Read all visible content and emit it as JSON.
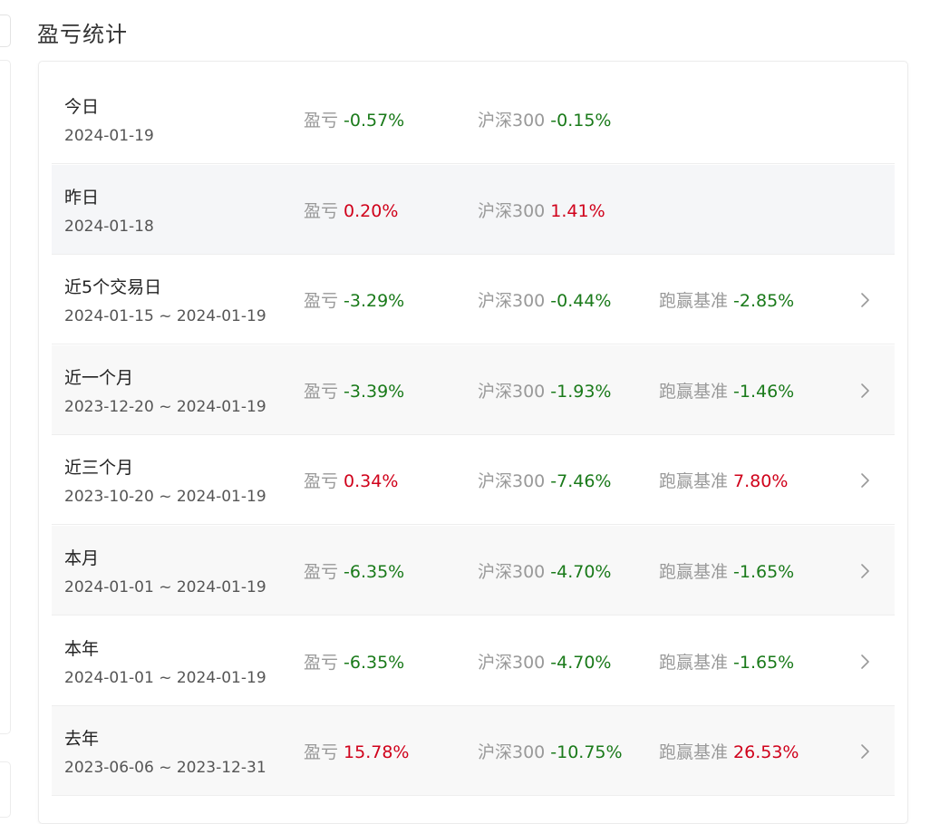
{
  "title": "盈亏统计",
  "labels": {
    "profit": "盈亏",
    "benchmark": "沪深300",
    "excess": "跑赢基准"
  },
  "colors": {
    "positive": "#d0021b",
    "negative": "#1a7a1a",
    "label": "#999999"
  },
  "rows": [
    {
      "name": "今日",
      "range": "2024-01-19",
      "profit": "-0.57%",
      "benchmark": "-0.15%",
      "excess": null
    },
    {
      "name": "昨日",
      "range": "2024-01-18",
      "profit": "0.20%",
      "benchmark": "1.41%",
      "excess": null
    },
    {
      "name": "近5个交易日",
      "range": "2024-01-15 ~ 2024-01-19",
      "profit": "-3.29%",
      "benchmark": "-0.44%",
      "excess": "-2.85%"
    },
    {
      "name": "近一个月",
      "range": "2023-12-20 ~ 2024-01-19",
      "profit": "-3.39%",
      "benchmark": "-1.93%",
      "excess": "-1.46%"
    },
    {
      "name": "近三个月",
      "range": "2023-10-20 ~ 2024-01-19",
      "profit": "0.34%",
      "benchmark": "-7.46%",
      "excess": "7.80%"
    },
    {
      "name": "本月",
      "range": "2024-01-01 ~ 2024-01-19",
      "profit": "-6.35%",
      "benchmark": "-4.70%",
      "excess": "-1.65%"
    },
    {
      "name": "本年",
      "range": "2024-01-01 ~ 2024-01-19",
      "profit": "-6.35%",
      "benchmark": "-4.70%",
      "excess": "-1.65%"
    },
    {
      "name": "去年",
      "range": "2023-06-06 ~ 2023-12-31",
      "profit": "15.78%",
      "benchmark": "-10.75%",
      "excess": "26.53%"
    }
  ]
}
